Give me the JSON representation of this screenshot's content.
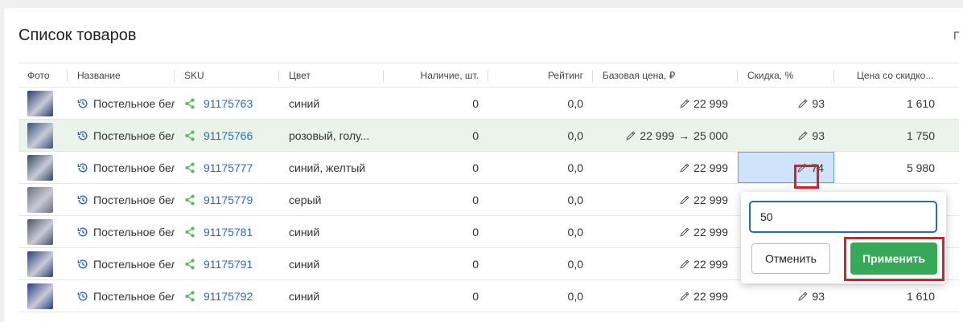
{
  "page": {
    "title": "Список товаров",
    "right_cut_text": "Г"
  },
  "table": {
    "headers": {
      "foto": "Фото",
      "name": "Название",
      "sku": "SKU",
      "color": "Цвет",
      "stock": "Наличие, шт.",
      "rating": "Рейтинг",
      "base_price": "Базовая цена, ₽",
      "discount": "Скидка, %",
      "final_price": "Цена со скидко..."
    },
    "rows": [
      {
        "name": "Постельное бел",
        "sku": "91175763",
        "color": "синий",
        "stock": "0",
        "rating": "0,0",
        "base_price": "22 999",
        "discount": "93",
        "final_price": "1 610",
        "thumb_color": "#2c3e6e"
      },
      {
        "name": "Постельное бел",
        "sku": "91175766",
        "color": "розовый, голу...",
        "stock": "0",
        "rating": "0,0",
        "base_price_old": "22 999",
        "base_price": "25 000",
        "discount": "93",
        "final_price": "1 750",
        "thumb_color": "#3b4f7a"
      },
      {
        "name": "Постельное бел",
        "sku": "91175777",
        "color": "синий, желтый",
        "stock": "0",
        "rating": "0,0",
        "base_price": "22 999",
        "discount": "74",
        "final_price": "5 980",
        "thumb_color": "#34495e"
      },
      {
        "name": "Постельное бел",
        "sku": "91175779",
        "color": "серый",
        "stock": "0",
        "rating": "0,0",
        "base_price": "22 999",
        "thumb_color": "#6b6f78"
      },
      {
        "name": "Постельное бел",
        "sku": "91175781",
        "color": "синий",
        "stock": "0",
        "rating": "0,0",
        "base_price": "22 999",
        "thumb_color": "#4a5066"
      },
      {
        "name": "Постельное бел",
        "sku": "91175791",
        "color": "синий",
        "stock": "0",
        "rating": "0,0",
        "base_price": "22 999",
        "thumb_color": "#2e3d78"
      },
      {
        "name": "Постельное бел",
        "sku": "91175792",
        "color": "синий",
        "stock": "0",
        "rating": "0,0",
        "base_price": "22 999",
        "discount": "93",
        "final_price": "1 610",
        "thumb_color": "#2a3a8a"
      }
    ]
  },
  "popup": {
    "input_value": "50",
    "cancel_label": "Отменить",
    "apply_label": "Применить"
  },
  "colors": {
    "link": "#2d6cb4",
    "share_green": "#5cb85c",
    "apply_green": "#37a85a",
    "highlight_row": "#eaf4ea",
    "annotation_red": "#d62222"
  },
  "icons": {
    "history": "history-icon",
    "share": "share-icon",
    "edit": "pencil-icon"
  }
}
